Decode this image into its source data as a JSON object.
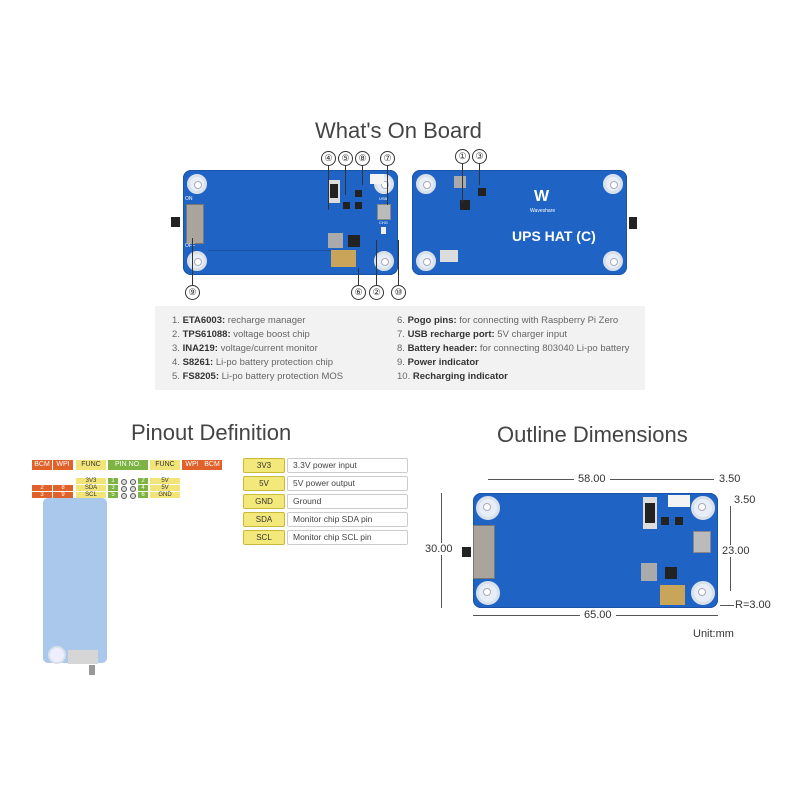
{
  "sections": {
    "whats_on_board": "What's On Board",
    "pinout_definition": "Pinout Definition",
    "outline_dimensions": "Outline Dimensions"
  },
  "board_front": {
    "callouts_top": [
      "④",
      "⑤",
      "⑧",
      "⑦"
    ],
    "callouts_bottom": [
      "⑨",
      "⑥",
      "②",
      "⑩"
    ],
    "silk_on": "ON",
    "silk_off": "OFF",
    "silk_usb": "USB",
    "silk_chg": "CHG"
  },
  "board_back": {
    "callouts_top": [
      "①",
      "③"
    ],
    "brand": "Waveshare",
    "product_name": "UPS HAT (C)"
  },
  "components": [
    {
      "num": "1.",
      "name": "ETA6003:",
      "desc": "recharge manager"
    },
    {
      "num": "2.",
      "name": "TPS61088:",
      "desc": "voltage boost chip"
    },
    {
      "num": "3.",
      "name": "INA219:",
      "desc": "voltage/current monitor"
    },
    {
      "num": "4.",
      "name": "S8261:",
      "desc": "Li-po battery protection chip"
    },
    {
      "num": "5.",
      "name": "FS8205:",
      "desc": "Li-po battery protection MOS"
    },
    {
      "num": "6.",
      "name": "Pogo pins:",
      "desc": "for connecting with Raspberry Pi Zero"
    },
    {
      "num": "7.",
      "name": "USB recharge port:",
      "desc": "5V charger input"
    },
    {
      "num": "8.",
      "name": "Battery header:",
      "desc": "for connecting 803040 Li-po battery"
    },
    {
      "num": "9.",
      "name": "Power indicator",
      "desc": ""
    },
    {
      "num": "10.",
      "name": "Recharging indicator",
      "desc": ""
    }
  ],
  "pinout": {
    "header": [
      "BCM",
      "WPI",
      "FUNC",
      "PIN NO.",
      "FUNC",
      "WPI",
      "BCM"
    ],
    "rows": [
      {
        "bcm_l": "",
        "wpi_l": "",
        "func_l": "3V3",
        "pin_l": "1",
        "pin_r": "2",
        "func_r": "5V"
      },
      {
        "bcm_l": "2",
        "wpi_l": "8",
        "func_l": "SDA",
        "pin_l": "3",
        "pin_r": "4",
        "func_r": "5V"
      },
      {
        "bcm_l": "3",
        "wpi_l": "9",
        "func_l": "SCL",
        "pin_l": "5",
        "pin_r": "6",
        "func_r": "GND"
      }
    ],
    "colors": {
      "bcm_wpi": "#e0612a",
      "func": "#f1e57a",
      "pin": "#7cb342"
    },
    "definitions": [
      {
        "key": "3V3",
        "desc": "3.3V power input"
      },
      {
        "key": "5V",
        "desc": "5V power output"
      },
      {
        "key": "GND",
        "desc": "Ground"
      },
      {
        "key": "SDA",
        "desc": "Monitor chip SDA pin"
      },
      {
        "key": "SCL",
        "desc": "Monitor chip SCL pin"
      }
    ]
  },
  "dimensions": {
    "hole_spacing_x": "58.00",
    "hole_offset_x": "3.50",
    "hole_offset_y": "3.50",
    "height": "30.00",
    "hole_spacing_y": "23.00",
    "width": "65.00",
    "corner_radius": "R=3.00",
    "unit": "Unit:mm"
  },
  "colors": {
    "pcb": "#1f63c4",
    "text": "#444444"
  }
}
